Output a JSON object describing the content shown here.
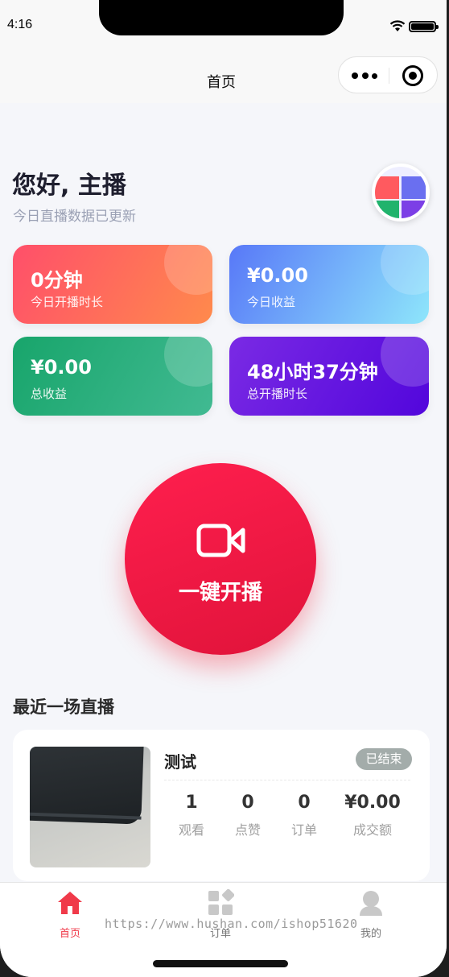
{
  "status_bar": {
    "time": "4:16"
  },
  "nav": {
    "title": "首页"
  },
  "greeting": {
    "title": "您好, 主播",
    "subtitle": "今日直播数据已更新"
  },
  "stats": [
    {
      "value": "0分钟",
      "label": "今日开播时长"
    },
    {
      "value": "¥0.00",
      "label": "今日收益"
    },
    {
      "value": "¥0.00",
      "label": "总收益"
    },
    {
      "value": "48小时37分钟",
      "label": "总开播时长"
    }
  ],
  "live_button": {
    "label": "一键开播"
  },
  "recent": {
    "section_title": "最近一场直播",
    "title": "测试",
    "status": "已结束",
    "metrics": [
      {
        "value": "1",
        "label": "观看"
      },
      {
        "value": "0",
        "label": "点赞"
      },
      {
        "value": "0",
        "label": "订单"
      },
      {
        "value": "¥0.00",
        "label": "成交额"
      }
    ]
  },
  "tabbar": {
    "items": [
      {
        "label": "首页",
        "icon": "home-icon",
        "active": true
      },
      {
        "label": "订单",
        "icon": "grid-icon",
        "active": false
      },
      {
        "label": "我的",
        "icon": "user-icon",
        "active": false
      }
    ]
  },
  "watermark": "https://www.hushan.com/ishop51620",
  "colors": {
    "accent": "#f03a4a",
    "live_button": "#ff1f4e"
  }
}
